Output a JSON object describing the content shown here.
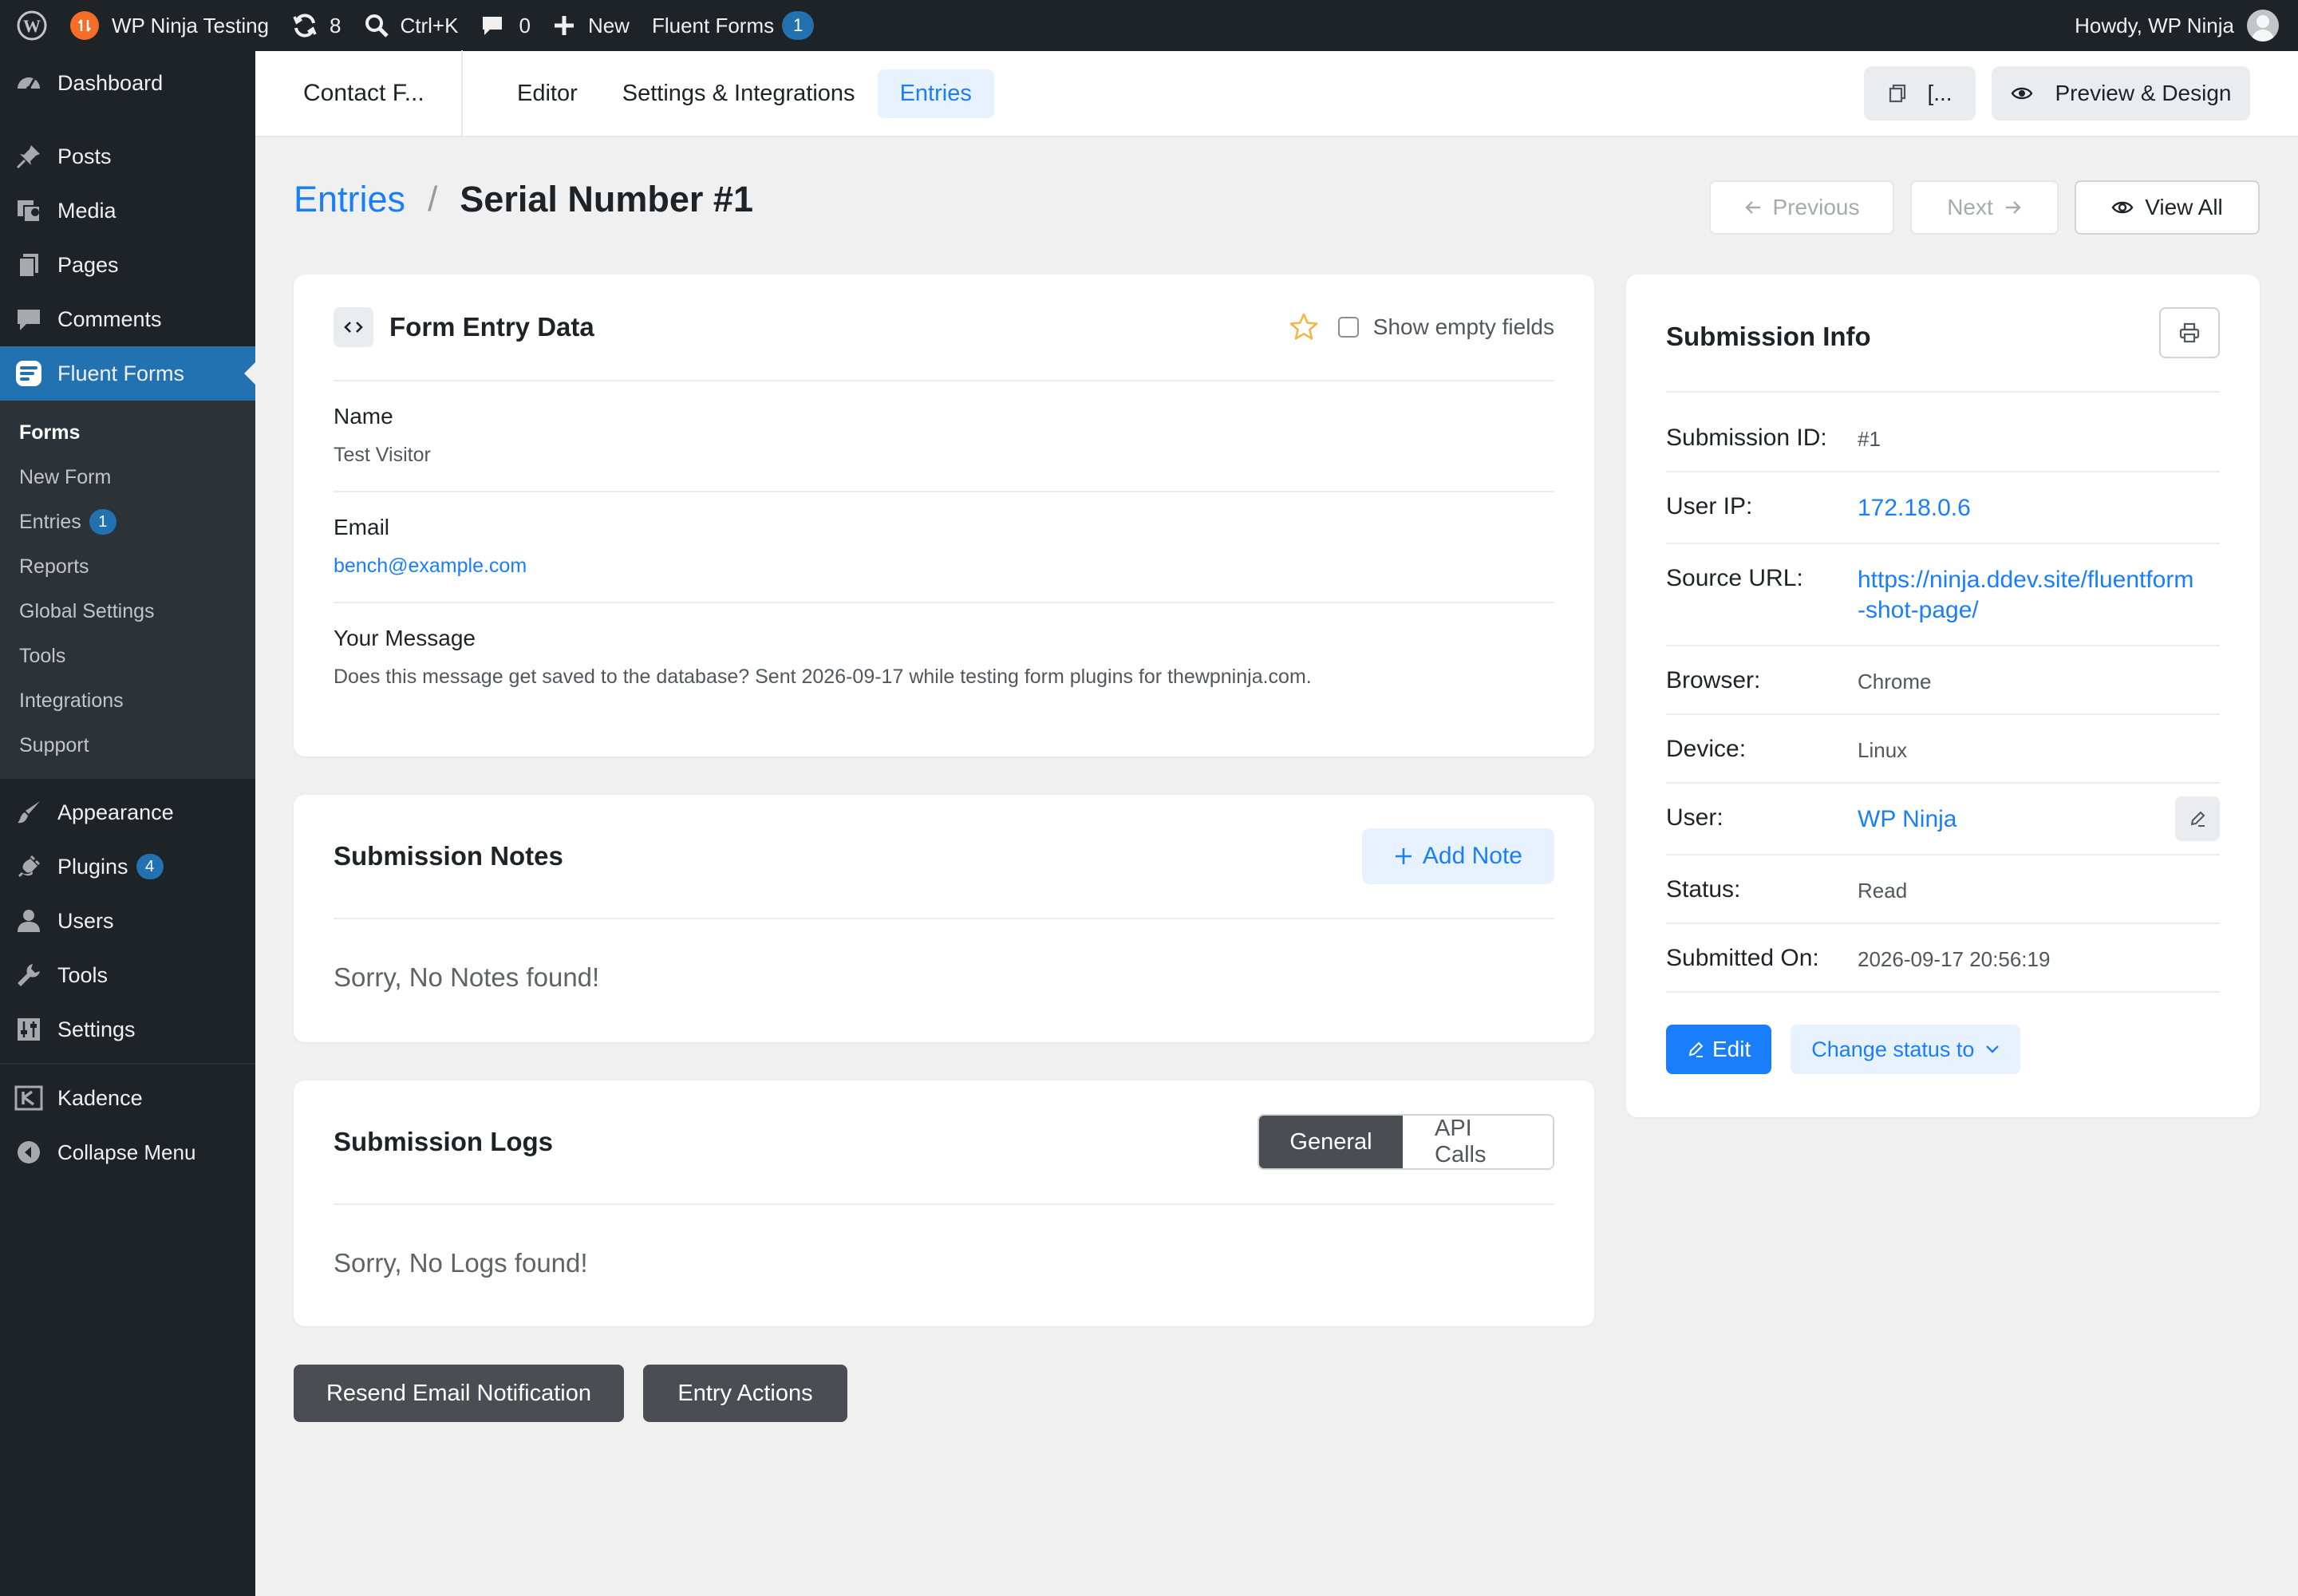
{
  "admin_bar": {
    "site_name": "WP Ninja Testing",
    "updates_count": "8",
    "search_shortcut": "Ctrl+K",
    "comments_count": "0",
    "new_label": "New",
    "fluent_forms_label": "Fluent Forms",
    "fluent_forms_badge": "1",
    "greeting": "Howdy, WP Ninja"
  },
  "sidebar": {
    "dashboard": "Dashboard",
    "posts": "Posts",
    "media": "Media",
    "pages": "Pages",
    "comments": "Comments",
    "fluent_forms": "Fluent Forms",
    "submenu": {
      "forms": "Forms",
      "new_form": "New Form",
      "entries": "Entries",
      "entries_badge": "1",
      "reports": "Reports",
      "global_settings": "Global Settings",
      "tools": "Tools",
      "integrations": "Integrations",
      "support": "Support"
    },
    "appearance": "Appearance",
    "plugins": "Plugins",
    "plugins_badge": "4",
    "users": "Users",
    "tools": "Tools",
    "settings": "Settings",
    "kadence": "Kadence",
    "collapse": "Collapse Menu"
  },
  "top_nav": {
    "form_title": "Contact F...",
    "tabs": [
      "Editor",
      "Settings & Integrations",
      "Entries"
    ],
    "shortcode_label": "[...",
    "preview_label": "Preview & Design"
  },
  "breadcrumb": {
    "parent": "Entries",
    "separator": "/",
    "current": "Serial Number #1"
  },
  "entry_nav": {
    "previous": "Previous",
    "next": "Next",
    "view_all": "View All"
  },
  "entry_data": {
    "title": "Form Entry Data",
    "show_empty_label": "Show empty fields",
    "fields": [
      {
        "label": "Name",
        "value": "Test Visitor"
      },
      {
        "label": "Email",
        "value": "bench@example.com"
      },
      {
        "label": "Your Message",
        "value": "Does this message get saved to the database? Sent 2026-09-17 while testing form plugins for thewpninja.com."
      }
    ]
  },
  "notes": {
    "title": "Submission Notes",
    "add_label": "Add Note",
    "empty": "Sorry, No Notes found!"
  },
  "logs": {
    "title": "Submission Logs",
    "tab_general": "General",
    "tab_api": "API Calls",
    "empty": "Sorry, No Logs found!"
  },
  "actions": {
    "resend": "Resend Email Notification",
    "entry_actions": "Entry Actions"
  },
  "submission_info": {
    "title": "Submission Info",
    "rows": [
      {
        "key": "Submission ID:",
        "value": "#1"
      },
      {
        "key": "User IP:",
        "value": "172.18.0.6"
      },
      {
        "key": "Source URL:",
        "value_line1": "https://ninja.ddev.site/fluentform",
        "value_line2": "-shot-page/"
      },
      {
        "key": "Browser:",
        "value": "Chrome"
      },
      {
        "key": "Device:",
        "value": "Linux"
      },
      {
        "key": "User:",
        "value": "WP Ninja"
      },
      {
        "key": "Status:",
        "value": "Read"
      },
      {
        "key": "Submitted On:",
        "value": "2026-09-17 20:56:19"
      }
    ],
    "edit_label": "Edit",
    "change_status_label": "Change status to"
  },
  "colors": {
    "admin_bg": "#1d2327",
    "wp_blue": "#2271b1",
    "accent": "#1a7efb",
    "page_bg": "#f0f0f1"
  },
  "icons": {
    "wp_logo": "wordpress-logo-icon",
    "updates": "refresh-icon",
    "search": "search-icon",
    "comments": "comment-bubble-icon",
    "new": "plus-icon",
    "star": "star-icon",
    "print": "print-icon",
    "eye": "eye-icon"
  }
}
